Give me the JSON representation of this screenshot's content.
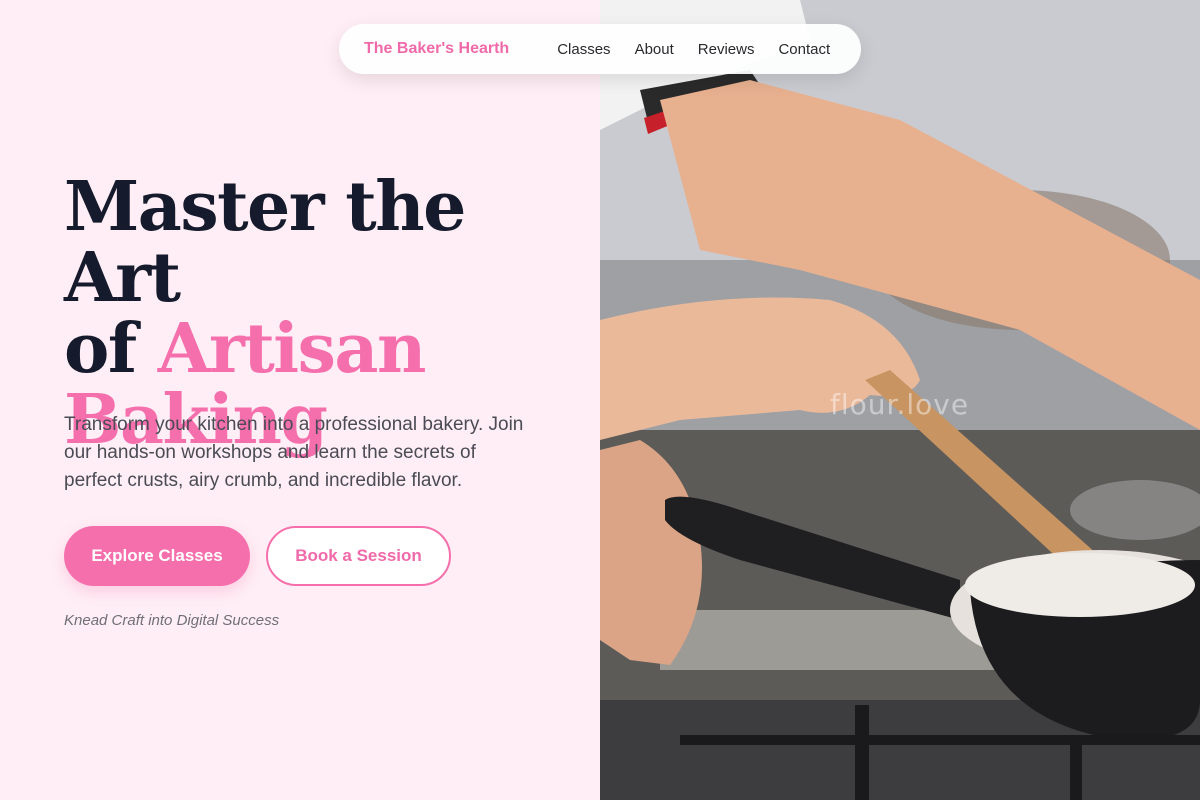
{
  "nav": {
    "brand": "The Baker's Hearth",
    "links": [
      "Classes",
      "About",
      "Reviews",
      "Contact"
    ]
  },
  "hero": {
    "headline_line1": "Master the Art",
    "headline_of": "of",
    "headline_accent1": "Artisan",
    "headline_accent2": "Baking",
    "lede": "Transform your kitchen into a professional bakery. Join our hands-on workshops and learn the secrets of perfect crusts, airy crumb, and incredible flavor.",
    "primary_cta": "Explore Classes",
    "secondary_cta": "Book a Session",
    "tagline": "Knead Craft into Digital Success"
  },
  "photo": {
    "watermark": "flour.love",
    "subject": "person stirring a pan with a wooden spoon on a gas stove"
  },
  "colors": {
    "accent": "#f56fac",
    "headline": "#151a2c",
    "background": "#ffeef5"
  }
}
